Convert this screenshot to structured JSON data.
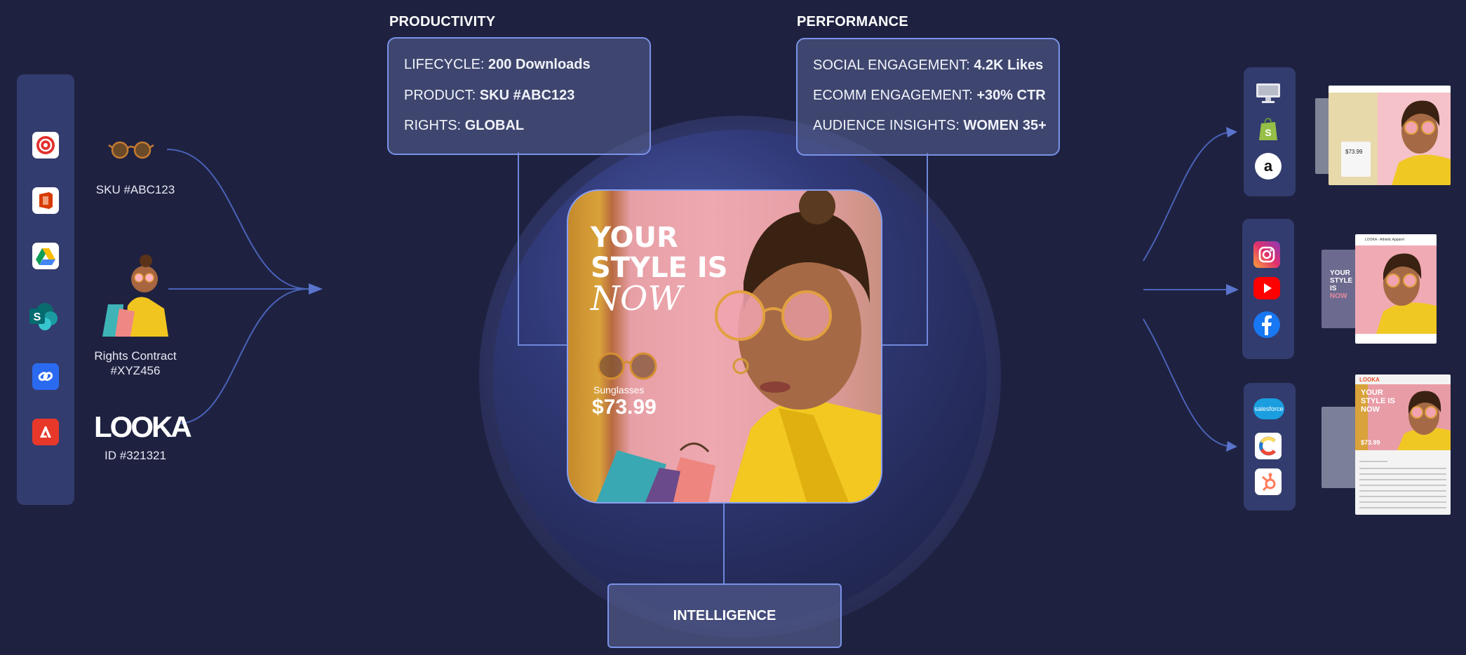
{
  "productivity": {
    "title": "PRODUCTIVITY",
    "rows": [
      {
        "label": "LIFECYCLE:",
        "value": "200 Downloads"
      },
      {
        "label": "PRODUCT:",
        "value": "SKU #ABC123"
      },
      {
        "label": "RIGHTS:",
        "value": "GLOBAL"
      }
    ]
  },
  "performance": {
    "title": "PERFORMANCE",
    "rows": [
      {
        "label": "SOCIAL ENGAGEMENT:",
        "value": "4.2K Likes"
      },
      {
        "label": "ECOMM ENGAGEMENT:",
        "value": "+30% CTR"
      },
      {
        "label": "AUDIENCE INSIGHTS:",
        "value": "WOMEN 35+"
      }
    ]
  },
  "intelligence": {
    "label": "INTELLIGENCE"
  },
  "sources": {
    "icons": [
      "sitecore-icon",
      "office-icon",
      "google-drive-icon",
      "sharepoint-icon",
      "link-icon",
      "adobe-icon"
    ],
    "items": [
      {
        "caption": "SKU #ABC123"
      },
      {
        "caption_line1": "Rights Contract",
        "caption_line2": "#XYZ456"
      },
      {
        "logo": "LOOKA",
        "caption": "ID #321321"
      }
    ]
  },
  "hero": {
    "line1": "YOUR",
    "line2": "STYLE IS",
    "line3": "NOW",
    "product": "Sunglasses",
    "price": "$73.99"
  },
  "destinations": {
    "ecommerce": [
      "desktop-icon",
      "shopify-icon",
      "amazon-icon"
    ],
    "social": [
      "instagram-icon",
      "youtube-icon",
      "facebook-icon"
    ],
    "marketing": [
      "salesforce-icon",
      "contentful-icon",
      "hubspot-icon"
    ],
    "salesforce_label": "salesforce",
    "amazon_label": "a",
    "shop_price": "$73.99",
    "email_header": "LOOKA",
    "email_title_line1": "YOUR",
    "email_title_line2": "STYLE IS",
    "email_title_line3": "NOW",
    "email_price": "$73.99",
    "social_title": "LOOKA - Athletic Apparel",
    "social_side_text1": "YOUR",
    "social_side_text2": "STYLE IS",
    "social_side_text3": "NOW"
  },
  "colors": {
    "background": "#1e2240",
    "box_border": "#7a92e8",
    "panel": "#333c6e"
  }
}
